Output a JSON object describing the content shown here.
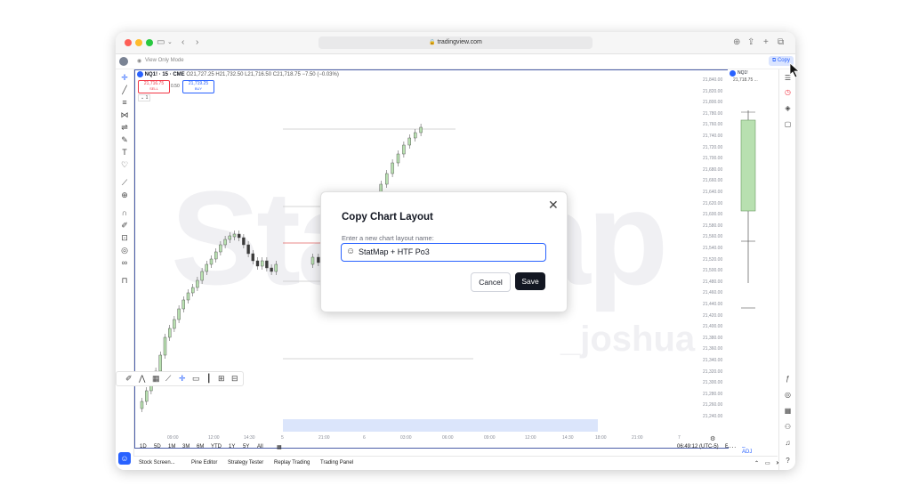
{
  "browser": {
    "url": "tradingview.com",
    "traffic_lights": [
      "#fe5f57",
      "#febc2e",
      "#28c840"
    ]
  },
  "infobar": {
    "view_only": "View Only Mode",
    "copy_label": "Copy"
  },
  "symbol": {
    "name": "NQ1! · 15 · CME",
    "ohlc": "O21,727.25 H21,732.50 L21,716.50 C21,718.75 −7.50 (−0.03%)",
    "sell_price": "21,716.75",
    "sell_label": "SELL",
    "spread": "0.50",
    "buy_price": "21,719.25",
    "buy_label": "BUY",
    "collapse": "⌄ 1"
  },
  "price_axis": [
    "21,840.00",
    "21,820.00",
    "21,800.00",
    "21,780.00",
    "21,760.00",
    "21,740.00",
    "21,720.00",
    "21,700.00",
    "21,680.00",
    "21,660.00",
    "21,640.00",
    "21,620.00",
    "21,600.00",
    "21,580.00",
    "21,560.00",
    "21,540.00",
    "21,520.00",
    "21,500.00",
    "21,480.00",
    "21,460.00",
    "21,440.00",
    "21,420.00",
    "21,400.00",
    "21,380.00",
    "21,360.00",
    "21,340.00",
    "21,320.00",
    "21,300.00",
    "21,280.00",
    "21,260.00",
    "21,240.00"
  ],
  "time_axis": [
    "09:00",
    "12:00",
    "14:30",
    "5",
    "21:00",
    "6",
    "03:00",
    "06:00",
    "09:00",
    "12:00",
    "14:30",
    "18:00",
    "21:00",
    "7"
  ],
  "timeframes": [
    "1D",
    "5D",
    "1M",
    "3M",
    "6M",
    "YTD",
    "1Y",
    "5Y",
    "All"
  ],
  "clock": "06:49:12 (UTC-5)",
  "session": "ETH",
  "adj": "B-ADJ",
  "bottom_tabs": [
    "Stock Screen...",
    "Pine Editor",
    "Strategy Tester",
    "Replay Trading",
    "Trading Panel"
  ],
  "right_panel": {
    "symbol": "NQ1!",
    "value": "21,718.75 ..."
  },
  "modal": {
    "title": "Copy Chart Layout",
    "input_label": "Enter a new chart layout name:",
    "input_value": "StatMap + HTF Po3",
    "cancel": "Cancel",
    "save": "Save"
  },
  "watermark": {
    "main": "StatMap",
    "sub": "_joshua"
  },
  "colors": {
    "accent": "#2962ff",
    "up_candle": "#b8e0b0",
    "down_candle": "#3a3a3a",
    "sell": "#f23645",
    "buy": "#2962ff"
  }
}
